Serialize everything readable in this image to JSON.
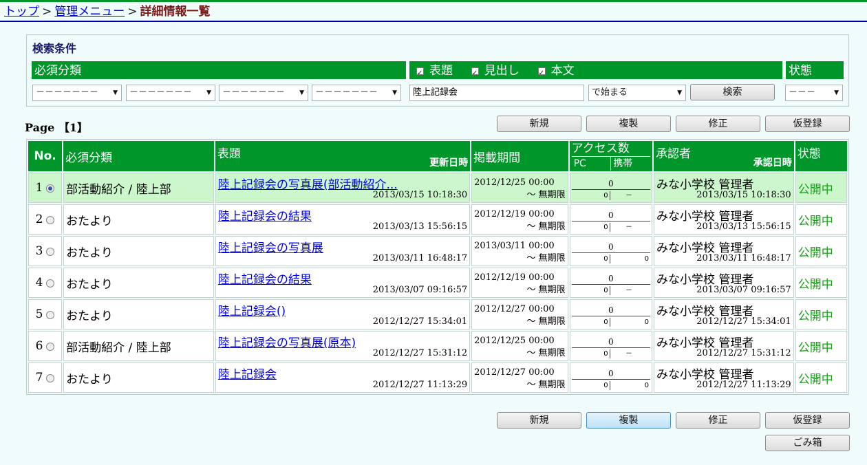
{
  "breadcrumb": {
    "top": "トップ",
    "menu": "管理メニュー",
    "current": "詳細情報一覧",
    "sep": ">"
  },
  "search": {
    "title": "検索条件",
    "category_header": "必須分類",
    "checks": [
      "表題",
      "見出し",
      "本文"
    ],
    "status_header": "状態",
    "category_selects": [
      "－－－－－－－",
      "－－－－－－－",
      "－－－－－－－",
      "－－－－－－－"
    ],
    "keyword": "陸上記録会",
    "match_mode": "で始まる",
    "search_button": "検索",
    "status_select": "－－－"
  },
  "page_label": "Page 【1】",
  "actions": {
    "new": "新規",
    "copy": "複製",
    "edit": "修正",
    "draft": "仮登録",
    "trash": "ごみ箱"
  },
  "table": {
    "headers": {
      "no": "No.",
      "category": "必須分類",
      "title": "表題",
      "updated": "更新日時",
      "period": "掲載期間",
      "access": "アクセス数",
      "pc": "PC",
      "mobile": "携帯",
      "approver": "承認者",
      "approved": "承認日時",
      "status": "状態"
    },
    "rows": [
      {
        "no": "1",
        "category": "部活動紹介 / 陸上部",
        "title": "陸上記録会の写真展(部活動紹介...",
        "updated": "2013/03/15 10:18:30",
        "start": "2012/12/25 00:00",
        "end": "～ 無期限",
        "total": "0",
        "pc": "0",
        "mobile": "－",
        "approver": "みな小学校 管理者",
        "approved": "2013/03/15 10:18:30",
        "status": "公開中"
      },
      {
        "no": "2",
        "category": "おたより",
        "title": "陸上記録会の結果",
        "updated": "2013/03/13 15:56:15",
        "start": "2012/12/19 00:00",
        "end": "～ 無期限",
        "total": "0",
        "pc": "0",
        "mobile": "－",
        "approver": "みな小学校 管理者",
        "approved": "2013/03/13 15:56:15",
        "status": "公開中"
      },
      {
        "no": "3",
        "category": "おたより",
        "title": "陸上記録会の写真展",
        "updated": "2013/03/11 16:48:17",
        "start": "2013/03/11 00:00",
        "end": "～ 無期限",
        "total": "0",
        "pc": "0",
        "mobile": "0",
        "approver": "みな小学校 管理者",
        "approved": "2013/03/11 16:48:17",
        "status": "公開中"
      },
      {
        "no": "4",
        "category": "おたより",
        "title": "陸上記録会の結果",
        "updated": "2013/03/07 09:16:57",
        "start": "2012/12/19 00:00",
        "end": "～ 無期限",
        "total": "0",
        "pc": "0",
        "mobile": "－",
        "approver": "みな小学校 管理者",
        "approved": "2013/03/07 09:16:57",
        "status": "公開中"
      },
      {
        "no": "5",
        "category": "おたより",
        "title": "陸上記録会()",
        "updated": "2012/12/27 15:34:01",
        "start": "2012/12/27 00:00",
        "end": "～ 無期限",
        "total": "0",
        "pc": "0",
        "mobile": "0",
        "approver": "みな小学校 管理者",
        "approved": "2012/12/27 15:34:01",
        "status": "公開中"
      },
      {
        "no": "6",
        "category": "部活動紹介 / 陸上部",
        "title": "陸上記録会の写真展(原本)",
        "updated": "2012/12/27 15:31:12",
        "start": "2012/12/25 00:00",
        "end": "～ 無期限",
        "total": "0",
        "pc": "0",
        "mobile": "－",
        "approver": "みな小学校 管理者",
        "approved": "2012/12/27 15:31:12",
        "status": "公開中"
      },
      {
        "no": "7",
        "category": "おたより",
        "title": "陸上記録会",
        "updated": "2012/12/27 11:13:29",
        "start": "2012/12/27 00:00",
        "end": "～ 無期限",
        "total": "0",
        "pc": "0",
        "mobile": "0",
        "approver": "みな小学校 管理者",
        "approved": "2012/12/27 11:13:29",
        "status": "公開中"
      }
    ]
  },
  "colors": {
    "header_green": "#00962a",
    "status_green": "#1aa01a",
    "selected_row": "#ccf7cc",
    "background": "#f0fcfc",
    "link": "#0000ee"
  }
}
